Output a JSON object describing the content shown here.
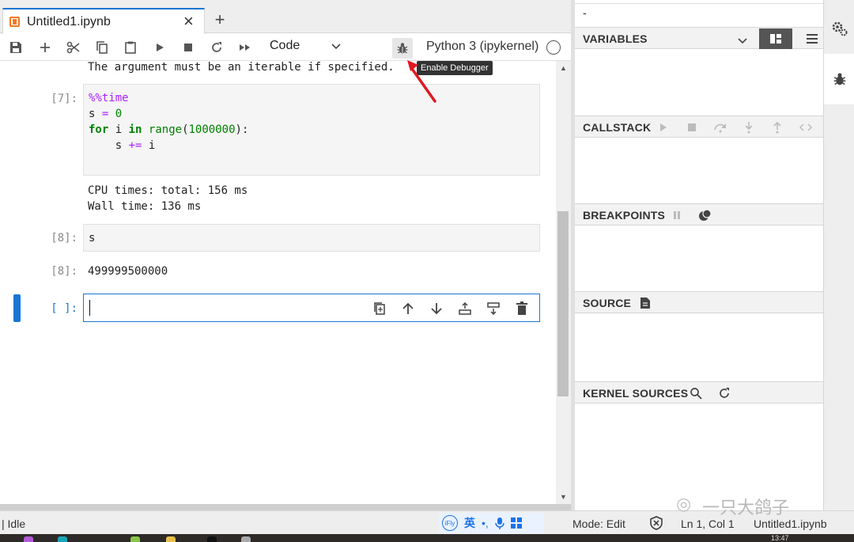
{
  "tab": {
    "label": "Untitled1.ipynb",
    "close": "×",
    "add": "+"
  },
  "toolbar": {
    "cell_type": "Code",
    "kernel": "Python 3 (ipykernel)"
  },
  "tooltip": "Enable Debugger",
  "notebook": {
    "truncated_output": "The argument must be an iterable if specified.",
    "cells": [
      {
        "prompt": "[7]:",
        "code": {
          "line1_magic": "%%time",
          "line2_a": "s",
          "line2_op": "=",
          "line2_num": "0",
          "line3_for": "for",
          "line3_var": "i",
          "line3_in": "in",
          "line3_fn": "range",
          "line3_num": "1000000",
          "line3_end": "):",
          "line4_a": "s",
          "line4_op": "+=",
          "line4_b": "i"
        },
        "output_lines": [
          "CPU times: total: 156 ms",
          "Wall time: 136 ms"
        ]
      },
      {
        "prompt": "[8]:",
        "code_text": "s",
        "out_prompt": "[8]:",
        "output": "499999500000"
      },
      {
        "prompt": "[ ]:"
      }
    ]
  },
  "debugger": {
    "title": "-",
    "sections": {
      "variables": "VARIABLES",
      "callstack": "CALLSTACK",
      "breakpoints": "BREAKPOINTS",
      "source": "SOURCE",
      "kernel_sources": "KERNEL SOURCES"
    }
  },
  "statusbar": {
    "mode_left": "| Idle",
    "mode": "Mode: Edit",
    "position": "Ln 1, Col 1",
    "file": "Untitled1.ipynb",
    "watermark": "一只大鸽子",
    "ime_lang": "英",
    "clock": "13:47"
  },
  "colors": {
    "accent": "#1976d2",
    "jupyter_orange": "#f37726",
    "arrow_red": "#e0191f"
  }
}
